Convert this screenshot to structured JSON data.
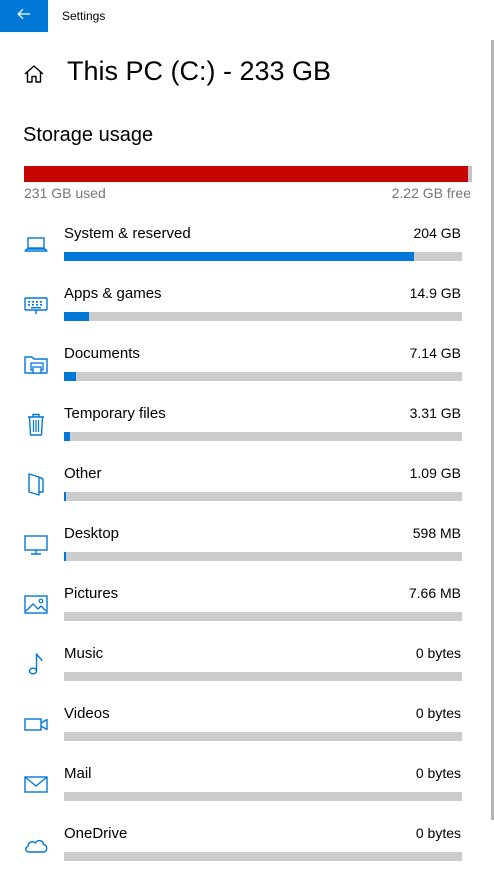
{
  "window": {
    "title": "Settings",
    "back_icon": "arrow-left-icon"
  },
  "header": {
    "title": "This PC (C:) - 233 GB",
    "icon": "home-icon"
  },
  "storage": {
    "section_title": "Storage usage",
    "used_label": "231 GB used",
    "free_label": "2.22 GB free",
    "used_fraction": 0.99
  },
  "categories": [
    {
      "name": "System & reserved",
      "size": "204 GB",
      "fraction": 0.88,
      "icon": "laptop-icon"
    },
    {
      "name": "Apps & games",
      "size": "14.9 GB",
      "fraction": 0.064,
      "icon": "keyboard-icon"
    },
    {
      "name": "Documents",
      "size": "7.14 GB",
      "fraction": 0.03,
      "icon": "folder-printer-icon"
    },
    {
      "name": "Temporary files",
      "size": "3.31 GB",
      "fraction": 0.014,
      "icon": "trash-icon"
    },
    {
      "name": "Other",
      "size": "1.09 GB",
      "fraction": 0.005,
      "icon": "document-folded-icon"
    },
    {
      "name": "Desktop",
      "size": "598 MB",
      "fraction": 0.003,
      "icon": "monitor-icon"
    },
    {
      "name": "Pictures",
      "size": "7.66 MB",
      "fraction": 0,
      "icon": "picture-icon"
    },
    {
      "name": "Music",
      "size": "0 bytes",
      "fraction": 0,
      "icon": "music-note-icon"
    },
    {
      "name": "Videos",
      "size": "0 bytes",
      "fraction": 0,
      "icon": "video-camera-icon"
    },
    {
      "name": "Mail",
      "size": "0 bytes",
      "fraction": 0,
      "icon": "mail-icon"
    },
    {
      "name": "OneDrive",
      "size": "0 bytes",
      "fraction": 0,
      "icon": "cloud-icon"
    }
  ],
  "colors": {
    "accent": "#0078d7",
    "used_bar": "#c50500",
    "bar_track": "#cccccc",
    "muted_text": "#767676"
  }
}
